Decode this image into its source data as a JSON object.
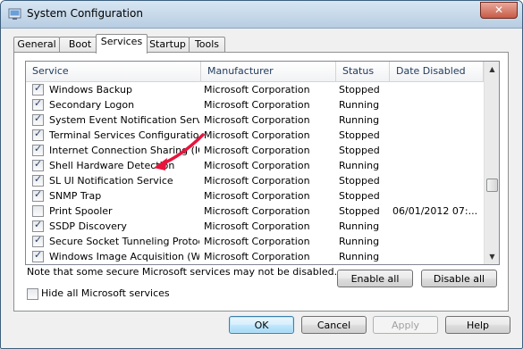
{
  "window": {
    "title": "System Configuration",
    "close_label": "✕"
  },
  "tabs": [
    "General",
    "Boot",
    "Services",
    "Startup",
    "Tools"
  ],
  "active_tab": "Services",
  "list": {
    "columns": [
      "Service",
      "Manufacturer",
      "Status",
      "Date Disabled"
    ],
    "rows": [
      {
        "checked": true,
        "service": "Windows Backup",
        "manufacturer": "Microsoft Corporation",
        "status": "Stopped",
        "date": ""
      },
      {
        "checked": true,
        "service": "Secondary Logon",
        "manufacturer": "Microsoft Corporation",
        "status": "Running",
        "date": ""
      },
      {
        "checked": true,
        "service": "System Event Notification Service",
        "manufacturer": "Microsoft Corporation",
        "status": "Running",
        "date": ""
      },
      {
        "checked": true,
        "service": "Terminal Services Configuration",
        "manufacturer": "Microsoft Corporation",
        "status": "Stopped",
        "date": ""
      },
      {
        "checked": true,
        "service": "Internet Connection Sharing (ICS)",
        "manufacturer": "Microsoft Corporation",
        "status": "Stopped",
        "date": ""
      },
      {
        "checked": true,
        "service": "Shell Hardware Detection",
        "manufacturer": "Microsoft Corporation",
        "status": "Running",
        "date": ""
      },
      {
        "checked": true,
        "service": "SL UI Notification Service",
        "manufacturer": "Microsoft Corporation",
        "status": "Stopped",
        "date": ""
      },
      {
        "checked": true,
        "service": "SNMP Trap",
        "manufacturer": "Microsoft Corporation",
        "status": "Stopped",
        "date": ""
      },
      {
        "checked": false,
        "service": "Print Spooler",
        "manufacturer": "Microsoft Corporation",
        "status": "Stopped",
        "date": "06/01/2012 07:..."
      },
      {
        "checked": true,
        "service": "SSDP Discovery",
        "manufacturer": "Microsoft Corporation",
        "status": "Running",
        "date": ""
      },
      {
        "checked": true,
        "service": "Secure Socket Tunneling Protoc...",
        "manufacturer": "Microsoft Corporation",
        "status": "Running",
        "date": ""
      },
      {
        "checked": true,
        "service": "Windows Image Acquisition (WIA)",
        "manufacturer": "Microsoft Corporation",
        "status": "Running",
        "date": ""
      }
    ]
  },
  "note": "Note that some secure Microsoft services may not be disabled.",
  "enable_all": "Enable all",
  "disable_all": "Disable all",
  "hide_label": "Hide all Microsoft services",
  "hide_checked": false,
  "buttons": {
    "ok": "OK",
    "cancel": "Cancel",
    "apply": "Apply",
    "help": "Help"
  },
  "scroll_up_icon": "▲",
  "scroll_down_icon": "▼",
  "colors": {
    "annotation_arrow": "#e8143c",
    "title_bar": "#c4d7ea",
    "default_button": "#3c7fb1"
  }
}
